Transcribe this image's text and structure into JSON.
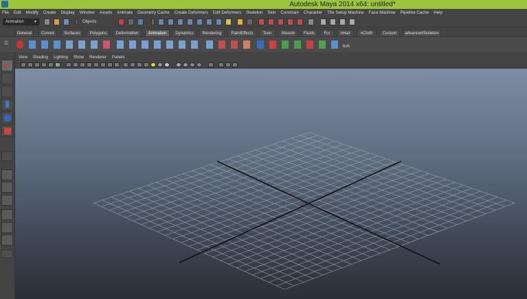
{
  "window": {
    "title": "Autodesk Maya 2014 x64: untitled*"
  },
  "menubar": [
    "File",
    "Edit",
    "Modify",
    "Create",
    "Display",
    "Window",
    "Assets",
    "Animate",
    "Geometry Cache",
    "Create Deformers",
    "Edit Deformers",
    "Skeleton",
    "Skin",
    "Constrain",
    "Character",
    "The Setup Machine",
    "Face Machine",
    "Pipeline Cache",
    "Help"
  ],
  "status_line": {
    "mode": "Animation",
    "selection_mask": "Objects"
  },
  "shelf": {
    "tabs": [
      "General",
      "Curves",
      "Surfaces",
      "Polygons",
      "Deformation",
      "Animation",
      "Dynamics",
      "Rendering",
      "PaintEffects",
      "Toon",
      "Muscle",
      "Fluids",
      "Fur",
      "nHair",
      "nCloth",
      "Custom",
      "advancedSkeleton"
    ],
    "active_tab": "Animation",
    "last_button_label": "bvh"
  },
  "panel": {
    "menus": [
      "View",
      "Shading",
      "Lighting",
      "Show",
      "Renderer",
      "Panels"
    ]
  },
  "colors": {
    "title_bar": "#9bc53d",
    "ui_bg": "#444444",
    "viewport_top": "#7d8da3",
    "viewport_bottom": "#2b2f36",
    "grid": "#9aa3ad",
    "axis": "#111111"
  }
}
